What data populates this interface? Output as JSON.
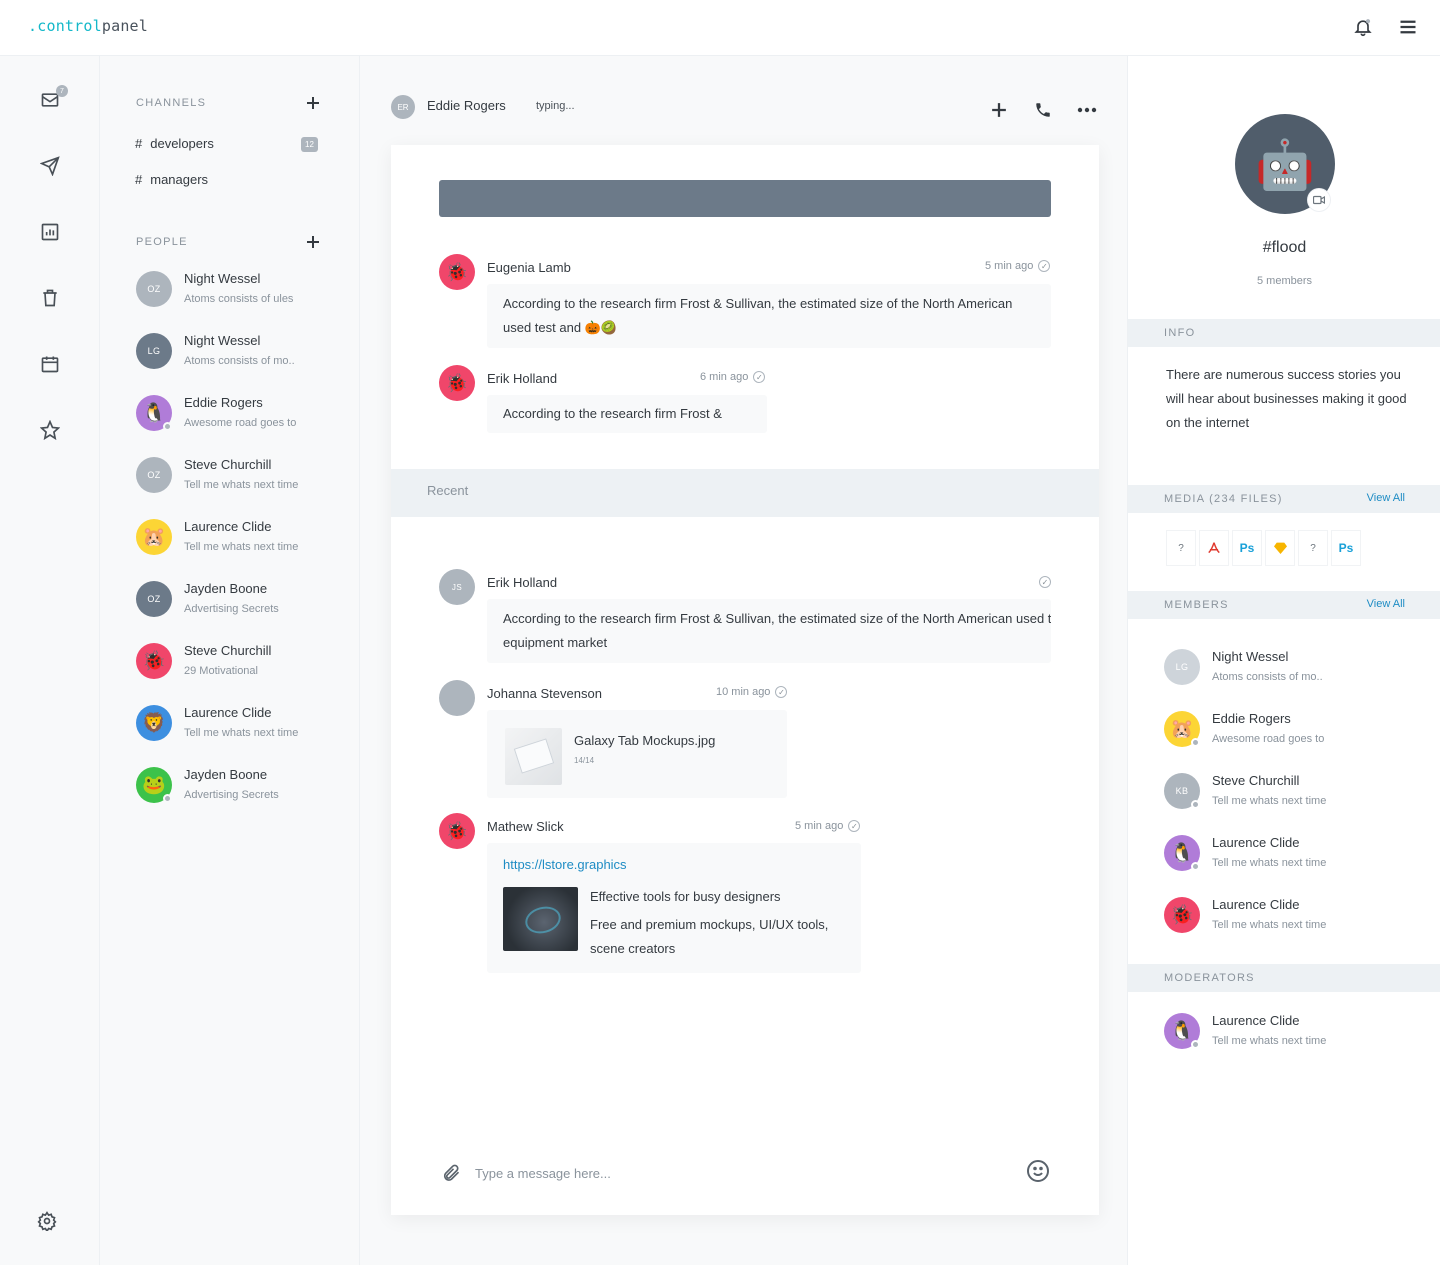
{
  "app": {
    "logo_prefix": ".",
    "logo_control": "control",
    "logo_panel": "panel"
  },
  "topbar": {
    "bell_icon": "bell-icon",
    "menu_icon": "hamburger-icon"
  },
  "rail": {
    "mail_badge": "7",
    "items": [
      "inbox-icon",
      "send-icon",
      "chart-icon",
      "trash-icon",
      "calendar-icon",
      "star-icon"
    ],
    "settings_icon": "gear-icon"
  },
  "sidebar": {
    "channels_title": "CHANNELS",
    "channels": [
      {
        "hash": "#",
        "name": "developers",
        "count": "12"
      },
      {
        "hash": "#",
        "name": "managers"
      }
    ],
    "people_title": "PEOPLE",
    "people": [
      {
        "name": "Night Wessel",
        "sub": "Atoms consists of ules",
        "initials": "OZ",
        "color": "#adb5bd"
      },
      {
        "name": "Night Wessel",
        "sub": "Atoms consists of mo..",
        "initials": "LG",
        "color": "#6c7a89"
      },
      {
        "name": "Eddie Rogers",
        "sub": "Awesome road goes to",
        "emoji": "🐧",
        "color": "#b07cd8"
      },
      {
        "name": "Steve Churchill",
        "sub": "Tell me whats next time",
        "initials": "OZ",
        "color": "#adb5bd"
      },
      {
        "name": "Laurence Clide",
        "sub": "Tell me whats next time",
        "emoji": "🐹",
        "color": "#fcd535"
      },
      {
        "name": "Jayden Boone",
        "sub": "Advertising Secrets",
        "initials": "OZ",
        "color": "#6c7a89"
      },
      {
        "name": "Steve Churchill",
        "sub": "29 Motivational",
        "emoji": "🐞",
        "color": "#f0466a"
      },
      {
        "name": "Laurence Clide",
        "sub": "Tell me whats next time",
        "emoji": "🦁",
        "color": "#3d8fe0"
      },
      {
        "name": "Jayden Boone",
        "sub": "Advertising Secrets",
        "emoji": "🐸",
        "color": "#3cc24a"
      }
    ]
  },
  "chat": {
    "header": {
      "initials": "ER",
      "name": "Eddie Rogers",
      "status": "typing..."
    },
    "messages_top": [
      {
        "name": "Eugenia Lamb",
        "time": "5 min ago",
        "emoji": "🐞",
        "text1": "According to the research firm Frost & Sullivan, the estimated size of the North American",
        "text2": "used test and",
        "text2_emoji": "🎃🥝"
      },
      {
        "name": "Erik Holland",
        "time": "6 min ago",
        "emoji": "🐞",
        "text": "According to the research firm Frost &"
      }
    ],
    "recent_label": "Recent",
    "messages_bottom": [
      {
        "name": "Erik Holland",
        "initials": "JS",
        "text1": "According to the research firm Frost & Sullivan, the estimated size of the North American used t",
        "text2": "equipment market"
      },
      {
        "name": "Johanna Stevenson",
        "time": "10 min ago",
        "file_name": "Galaxy Tab Mockups.jpg",
        "file_meta": "14/14"
      },
      {
        "name": "Mathew Slick",
        "time": "5 min ago",
        "emoji": "🐞",
        "link": "https://lstore.graphics",
        "link_title": "Effective tools for busy designers",
        "link_desc1": "Free and premium mockups, UI/UX tools,",
        "link_desc2": "scene creators"
      }
    ],
    "composer": {
      "placeholder": "Type a message here..."
    }
  },
  "details": {
    "avatar_emoji": "🤖",
    "channel_name": "#flood",
    "members_count": "5 members",
    "info_title": "INFO",
    "info_text": "There are numerous success stories you will hear about businesses making it good on the internet",
    "media_title": "MEDIA (234 FILES)",
    "view_all": "View All",
    "media": [
      "?",
      "pdf-icon",
      "Ps",
      "sketch-icon",
      "?",
      "Ps"
    ],
    "members_title": "MEMBERS",
    "members": [
      {
        "name": "Night Wessel",
        "sub": "Atoms consists of mo..",
        "initials": "LG",
        "color": "#ced4da"
      },
      {
        "name": "Eddie Rogers",
        "sub": "Awesome road goes to",
        "emoji": "🐹",
        "color": "#fcd535"
      },
      {
        "name": "Steve Churchill",
        "sub": "Tell me whats next time",
        "initials": "KB",
        "color": "#adb5bd"
      },
      {
        "name": "Laurence Clide",
        "sub": "Tell me whats next time",
        "emoji": "🐧",
        "color": "#b07cd8"
      },
      {
        "name": "Laurence Clide",
        "sub": "Tell me whats next time",
        "emoji": "🐞",
        "color": "#f0466a"
      }
    ],
    "moderators_title": "MODERATORS",
    "moderators": [
      {
        "name": "Laurence Clide",
        "sub": "Tell me whats next time",
        "emoji": "🐧",
        "color": "#b07cd8"
      }
    ]
  }
}
